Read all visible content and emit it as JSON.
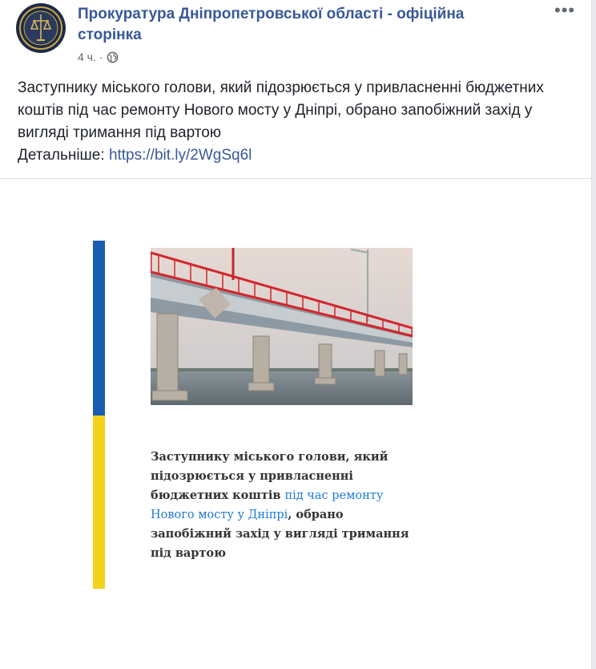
{
  "post": {
    "page_name": "Прокуратура Дніпропетровської області - офіційна сторінка",
    "time": "4 ч.",
    "separator": "·",
    "more": "•••",
    "text": "Заступнику міського голови, який підозрюється у привласненні бюджетних коштів під час ремонту Нового мосту у Дніпрі, обрано запобіжний захід у вигляді тримання під вартою",
    "link_prefix": "Детальніше: ",
    "link": "https://bit.ly/2WgSq6l"
  },
  "image_card": {
    "caption_part1": "Заступнику міського голови, який підозрюється у привласненні бюджетних коштів ",
    "caption_highlight": "під час ремонту Нового мосту у Дніпрі",
    "caption_part2": ", обрано запобіжний захід у вигляді тримання під вартою"
  },
  "colors": {
    "link": "#385898",
    "flag_blue": "#1a5db0",
    "flag_yellow": "#f4d11b",
    "caption_highlight": "#1f7bd8"
  }
}
